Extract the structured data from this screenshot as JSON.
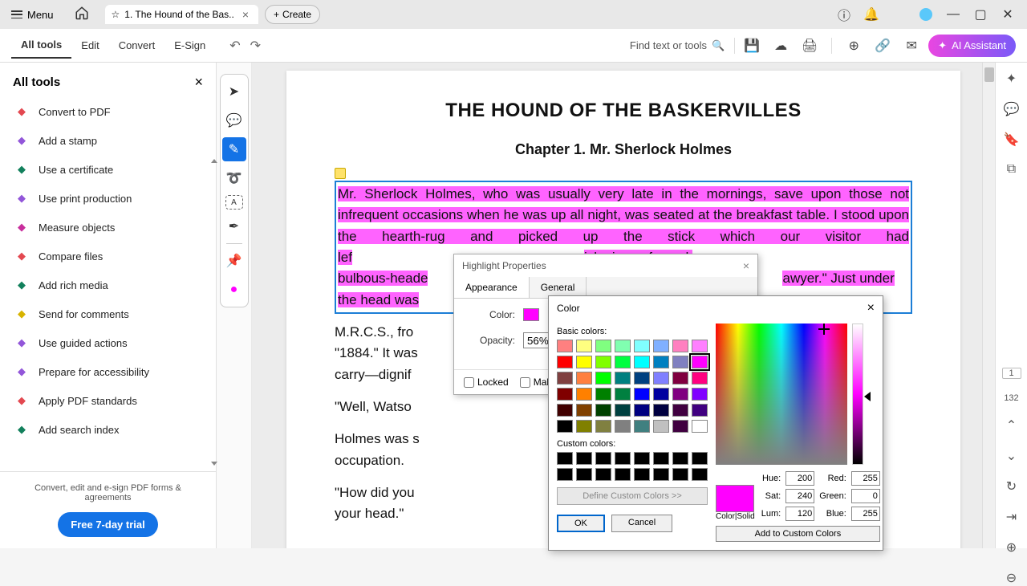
{
  "titlebar": {
    "menu": "Menu",
    "tabTitle": "1. The Hound of the Bas..",
    "create": "Create"
  },
  "toolbar": {
    "allTools": "All tools",
    "edit": "Edit",
    "convert": "Convert",
    "esign": "E-Sign",
    "find": "Find text or tools",
    "ai": "AI Assistant"
  },
  "sidebar": {
    "title": "All tools",
    "items": [
      {
        "label": "Convert to PDF",
        "color": "#e34850"
      },
      {
        "label": "Add a stamp",
        "color": "#9256d9"
      },
      {
        "label": "Use a certificate",
        "color": "#12805c"
      },
      {
        "label": "Use print production",
        "color": "#9256d9"
      },
      {
        "label": "Measure objects",
        "color": "#c82e9c"
      },
      {
        "label": "Compare files",
        "color": "#e34850"
      },
      {
        "label": "Add rich media",
        "color": "#12805c"
      },
      {
        "label": "Send for comments",
        "color": "#d7b300"
      },
      {
        "label": "Use guided actions",
        "color": "#9256d9"
      },
      {
        "label": "Prepare for accessibility",
        "color": "#9256d9"
      },
      {
        "label": "Apply PDF standards",
        "color": "#e34850"
      },
      {
        "label": "Add search index",
        "color": "#12805c"
      }
    ],
    "footerText": "Convert, edit and e-sign PDF forms & agreements",
    "trial": "Free 7-day trial"
  },
  "doc": {
    "title": "THE HOUND OF THE BASKERVILLES",
    "chapter": "Chapter 1. Mr. Sherlock Holmes",
    "highlighted": "Mr. Sherlock Holmes, who was usually very late in the mornings, save upon those not infrequent occasions when he was up all night, was seated at the breakfast table. I stood upon the hearth-rug and picked up the stick which our visitor had lef",
    "hl_rest1": "ick piece of wood,",
    "hl_rest2": "bulbous-heade",
    "hl_rest3": "awyer.\" Just under",
    "hl_rest4": "the head was",
    "p1_rest": "M.R.C.S., fro",
    "p1_rest2": "\"1884.\" It was",
    "p1_rest3": "carry—dignif",
    "p2": "\"Well, Watso",
    "p3": "Holmes was s",
    "p3b": "occupation.",
    "p4": "\"How did you",
    "p4b": "your head.\""
  },
  "hp": {
    "title": "Highlight Properties",
    "tabApp": "Appearance",
    "tabGen": "General",
    "colorLabel": "Color:",
    "opacityLabel": "Opacity:",
    "opacity": "56%",
    "locked": "Locked",
    "make": "Make"
  },
  "color": {
    "title": "Color",
    "basic": "Basic colors:",
    "custom": "Custom colors:",
    "define": "Define Custom Colors >>",
    "ok": "OK",
    "cancel": "Cancel",
    "colorsolid": "Color|Solid",
    "hue": "Hue:",
    "hueV": "200",
    "sat": "Sat:",
    "satV": "240",
    "lum": "Lum:",
    "lumV": "120",
    "red": "Red:",
    "redV": "255",
    "green": "Green:",
    "greenV": "0",
    "blue": "Blue:",
    "blueV": "255",
    "add": "Add to Custom Colors",
    "basicColors": [
      "#ff8080",
      "#ffff80",
      "#80ff80",
      "#80ffb0",
      "#80ffff",
      "#80b0ff",
      "#ff80c0",
      "#ff80ff",
      "#ff0000",
      "#ffff00",
      "#80ff00",
      "#00ff40",
      "#00ffff",
      "#0080c0",
      "#8080c0",
      "#ff00ff",
      "#804040",
      "#ff8040",
      "#00ff00",
      "#008080",
      "#004080",
      "#8080ff",
      "#800040",
      "#ff0080",
      "#800000",
      "#ff8000",
      "#008000",
      "#008040",
      "#0000ff",
      "#0000a0",
      "#800080",
      "#8000ff",
      "#400000",
      "#804000",
      "#004000",
      "#004040",
      "#000080",
      "#000040",
      "#400040",
      "#400080",
      "#000000",
      "#808000",
      "#808040",
      "#808080",
      "#408080",
      "#c0c0c0",
      "#400040",
      "#ffffff"
    ],
    "selectedIdx": 15
  },
  "pages": {
    "current": "1",
    "total": "132"
  }
}
